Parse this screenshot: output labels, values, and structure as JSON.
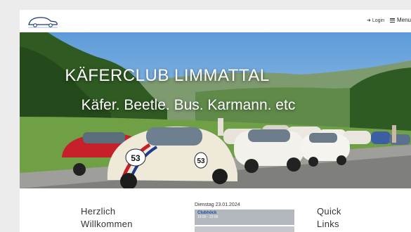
{
  "header": {
    "logo_icon": "car-logo-icon",
    "login_label": "Login",
    "menu_label": "Menu"
  },
  "hero": {
    "title": "KÄFERCLUB LIMMATTAL",
    "subtitle": "Käfer. Beetle. Bus. Karmann. etc",
    "car_number": "53"
  },
  "content": {
    "welcome_line1": "Herzlich",
    "welcome_line2": "Willkommen",
    "calendar": {
      "date": "Dienstag 23.01.2024",
      "event_title": "Clubhöck",
      "event_time": "19:00 - 22:00"
    },
    "quick_line1": "Quick",
    "quick_line2": "Links"
  },
  "colors": {
    "sky": "#7fb6e6",
    "hero_text": "#ffffff",
    "calendar_event": "#b3b7be"
  }
}
